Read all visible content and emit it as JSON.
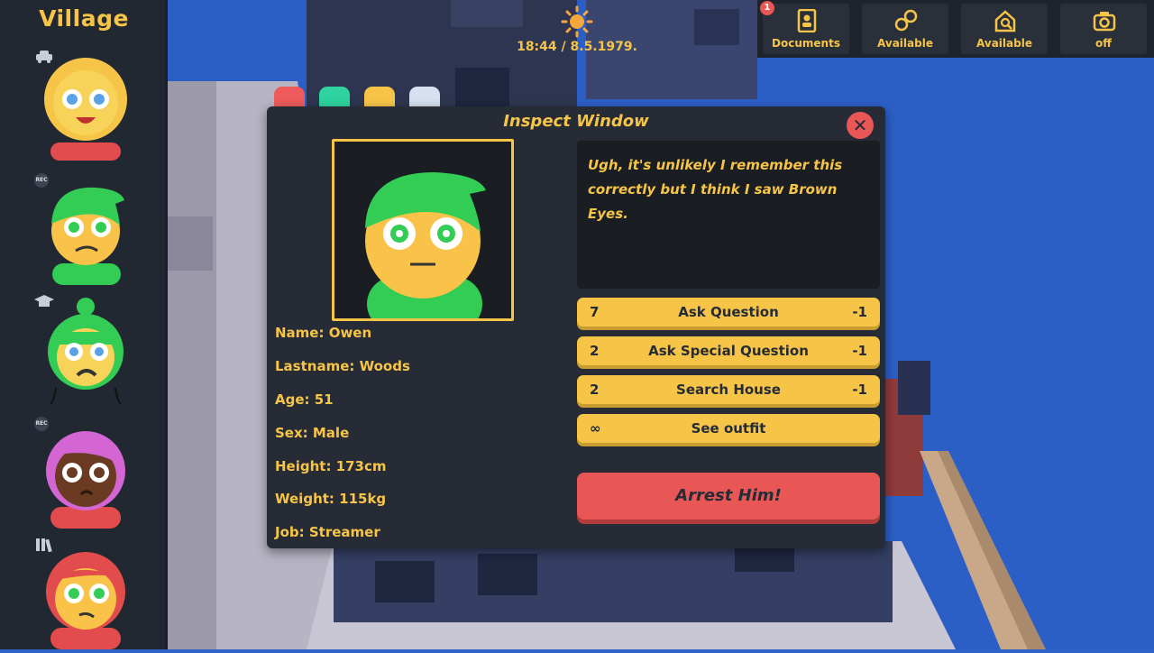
{
  "sidebar": {
    "title": "Village",
    "villagers": [
      {
        "face": "#f8d35a",
        "hair": "#f6c548",
        "shirt": "#e34c4c",
        "eyes": "#5aa2e8",
        "tag": "car-icon",
        "tag_text": ""
      },
      {
        "face": "#f8c348",
        "hair": "#33cc55",
        "shirt": "#33cc55",
        "eyes": "#33cc55",
        "tag": "rec-icon",
        "tag_text": "REC"
      },
      {
        "face": "#f8d35a",
        "hair": "#33cc55",
        "shirt": "#222831",
        "eyes": "#5aa2e8",
        "tag": "graduation-cap-icon",
        "tag_text": ""
      },
      {
        "face": "#6a3a22",
        "hair": "#d466d4",
        "shirt": "#e34c4c",
        "eyes": "#6a3a22",
        "tag": "rec-icon",
        "tag_text": "REC"
      },
      {
        "face": "#f8c348",
        "hair": "#e34c4c",
        "shirt": "#e34c4c",
        "eyes": "#33cc55",
        "tag": "books-icon",
        "tag_text": ""
      }
    ]
  },
  "topbar": {
    "badge": "1",
    "buttons": [
      {
        "label": "Documents",
        "icon": "id-card-icon"
      },
      {
        "label": "Available",
        "icon": "handcuffs-icon"
      },
      {
        "label": "Available",
        "icon": "house-search-icon"
      },
      {
        "label": "off",
        "icon": "camera-icon"
      }
    ]
  },
  "clock": "18:44 / 8.5.1979.",
  "swatches": [
    "#ef5b5b",
    "#2ed39e",
    "#f6c548",
    "#d6e0ee"
  ],
  "inspect": {
    "title": "Inspect Window",
    "close": "✕",
    "info": {
      "name": "Name: Owen",
      "lastname": "Lastname: Woods",
      "age": "Age: 51",
      "sex": "Sex: Male",
      "height": "Height: 173cm",
      "weight": "Weight: 115kg",
      "job": "Job: Streamer"
    },
    "speech": "Ugh, it's unlikely I remember this correctly but I think I saw Brown Eyes.",
    "actions": [
      {
        "count": "7",
        "label": "Ask Question",
        "cost": "-1"
      },
      {
        "count": "2",
        "label": "Ask Special Question",
        "cost": "-1"
      },
      {
        "count": "2",
        "label": "Search House",
        "cost": "-1"
      },
      {
        "count": "∞",
        "label": "See outfit",
        "cost": ""
      }
    ],
    "arrest": "Arrest Him!"
  }
}
